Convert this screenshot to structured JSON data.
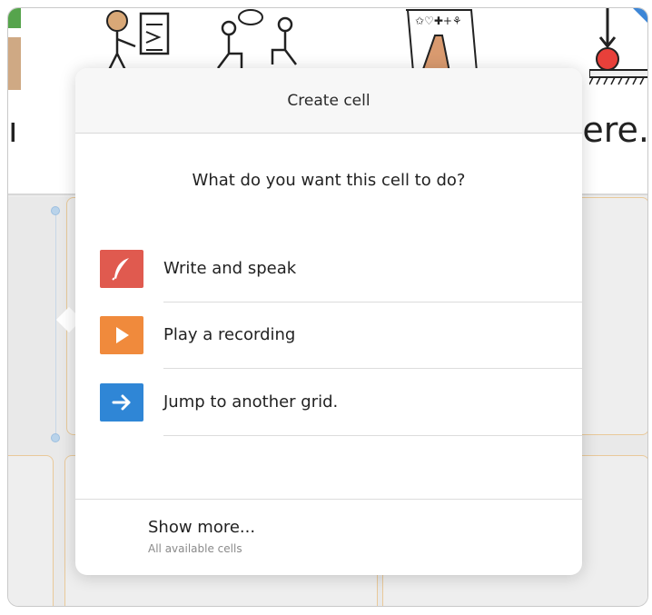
{
  "background": {
    "strip_left_text": "ı",
    "strip_right_text": "ere."
  },
  "dialog": {
    "title": "Create cell",
    "question": "What do you want this cell to do?",
    "options": [
      {
        "label": "Write and speak",
        "icon": "quill-pen-icon",
        "color": "#e05a4f"
      },
      {
        "label": "Play a recording",
        "icon": "play-icon",
        "color": "#f08a3c"
      },
      {
        "label": "Jump to another grid.",
        "icon": "right-arrow-icon",
        "color": "#2f86d6"
      }
    ],
    "show_more": {
      "label": "Show more...",
      "sublabel": "All available cells"
    }
  }
}
